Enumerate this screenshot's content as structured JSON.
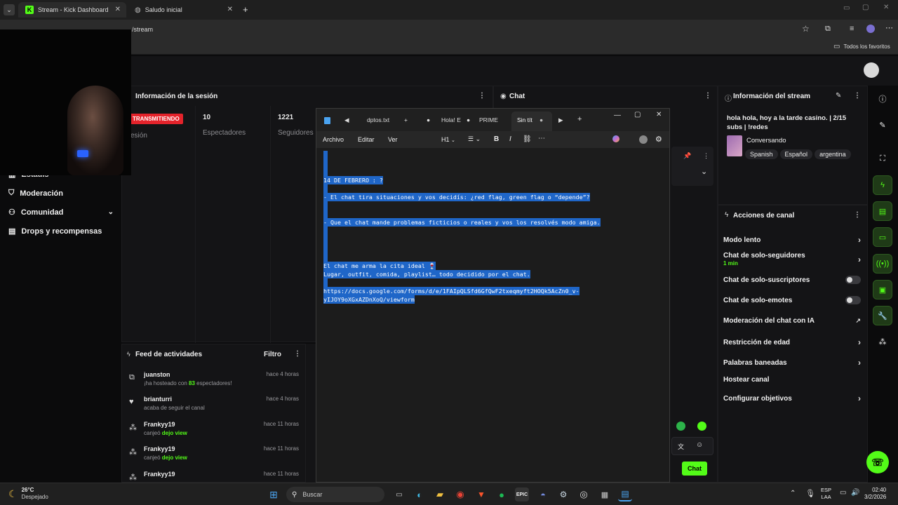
{
  "browser": {
    "tabs": [
      {
        "title": "Stream - Kick Dashboard",
        "active": true
      },
      {
        "title": "Saludo inicial",
        "active": false
      }
    ],
    "url_suffix": "/stream",
    "bookmarks_label": "Todos los favoritos"
  },
  "sidebar": {
    "items": [
      {
        "label": "Moderación",
        "icon": "shield-icon"
      },
      {
        "label": "Comunidad",
        "icon": "community-icon"
      },
      {
        "label": "Drops y recompensas",
        "icon": "gift-icon"
      }
    ],
    "partial_item": "Estadís"
  },
  "session": {
    "title": "Información de la sesión",
    "live_badge": "TRANSMITIENDO",
    "live_sub": "esión",
    "viewers_value": "10",
    "viewers_label": "Espectadores",
    "followers_value": "1221",
    "followers_label": "Seguidores"
  },
  "chat": {
    "title": "Chat",
    "send_label": "Chat"
  },
  "stream_info": {
    "title": "Información del stream",
    "stream_title": "hola hola, hoy a la tarde casino. | 2/15 subs | !redes",
    "category": "Conversando",
    "tags": [
      "Spanish",
      "Español",
      "argentina"
    ]
  },
  "channel_actions": {
    "title": "Acciones de canal",
    "items": [
      {
        "label": "Modo lento",
        "control": "chevron"
      },
      {
        "label": "Chat de solo-seguidores",
        "sub": "1 min",
        "control": "chevron"
      },
      {
        "label": "Chat de solo-suscriptores",
        "control": "toggle"
      },
      {
        "label": "Chat de solo-emotes",
        "control": "toggle"
      },
      {
        "label": "Moderación del chat con IA",
        "control": "external"
      },
      {
        "label": "Restricción de edad",
        "control": "chevron"
      },
      {
        "label": "Palabras baneadas",
        "control": "chevron"
      },
      {
        "label": "Hostear canal",
        "control": "none"
      },
      {
        "label": "Configurar objetivos",
        "control": "chevron"
      }
    ]
  },
  "feed": {
    "title": "Feed de actividades",
    "filter_label": "Filtro",
    "items": [
      {
        "user": "juanston",
        "desc_pre": "¡ha hosteado con ",
        "desc_highlight": "83",
        "desc_post": " espectadores!",
        "time": "hace 4 horas",
        "icon": "host-icon"
      },
      {
        "user": "brianturri",
        "desc_pre": "acaba de seguir el canal",
        "desc_highlight": "",
        "desc_post": "",
        "time": "hace 4 horas",
        "icon": "heart-icon"
      },
      {
        "user": "Frankyy19",
        "desc_pre": "canjeó ",
        "desc_highlight": "dejo view",
        "desc_post": "",
        "time": "hace 11 horas",
        "icon": "redeem-icon"
      },
      {
        "user": "Frankyy19",
        "desc_pre": "canjeó ",
        "desc_highlight": "dejo view",
        "desc_post": "",
        "time": "hace 11 horas",
        "icon": "redeem-icon"
      },
      {
        "user": "Frankyy19",
        "desc_pre": "",
        "desc_highlight": "",
        "desc_post": "",
        "time": "hace 11 horas",
        "icon": "redeem-icon"
      }
    ]
  },
  "notepad": {
    "tabs": [
      "dptos.txt",
      "Hola! E",
      "PRIME",
      "Sin tít"
    ],
    "menu": [
      "Archivo",
      "Editar",
      "Ver"
    ],
    "heading_label": "H1",
    "lines": [
      "14 DE FEBRERO : ?",
      "- El chat tira situaciones y vos decidís: ¿red flag, green flag o “depende”?",
      "- Que el chat mande problemas ficticios o reales y vos los resolvés modo amiga.",
      "El chat me arma la cita ideal 🍷",
      "Lugar, outfit, comida, playlist… todo decidido por el chat.",
      "https://docs.google.com/forms/d/e/1FAIpQLSfd6GfQwF2txeqmyft2HOQk5AcZn0_v-",
      "yIJOY9oXGxAZDnXoQ/viewform"
    ]
  },
  "taskbar": {
    "temp": "26°C",
    "weather": "Despejado",
    "search_label": "Buscar",
    "lang_top": "ESP",
    "lang_bottom": "LAA",
    "time": "02:40",
    "date": "3/2/2026"
  },
  "colors": {
    "kick_green": "#53fc18",
    "live_red": "#e4232b",
    "selection_blue": "#1f66c8"
  }
}
